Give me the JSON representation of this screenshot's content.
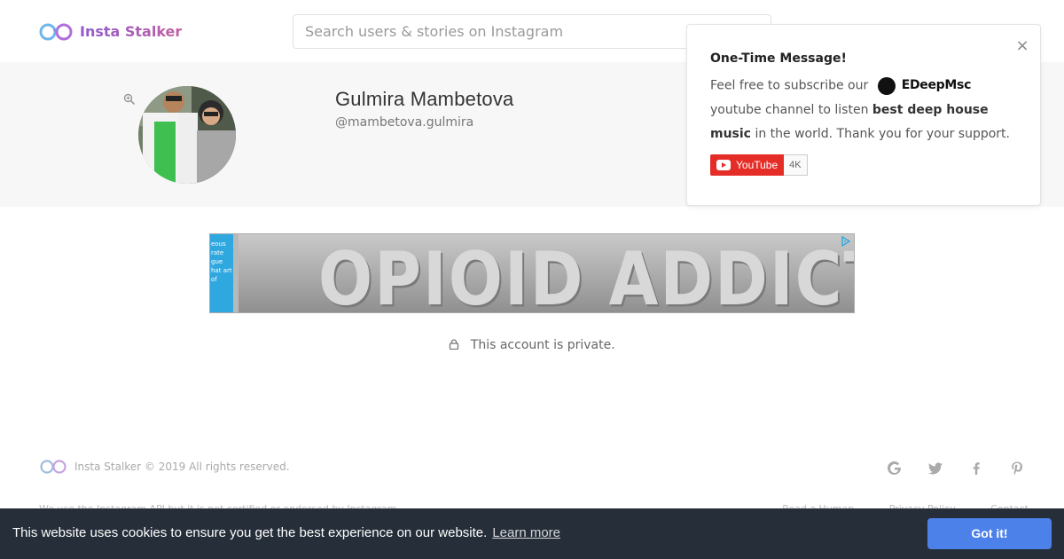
{
  "header": {
    "brand": "Insta Stalker",
    "search_placeholder": "Search users & stories on Instagram"
  },
  "profile": {
    "name": "Gulmira Mambetova",
    "handle": "@mambetova.gulmira"
  },
  "popup": {
    "title": "One-Time Message!",
    "text_before": "Feel free to subscribe our",
    "channel_name": "EDeepMsc",
    "text_after_channel": "youtube channel to listen",
    "highlight": "best deep house music",
    "text_end": "in the world. Thank you for your support.",
    "youtube_label": "YouTube",
    "youtube_count": "4K",
    "close_glyph": "×"
  },
  "ad": {
    "side_text": "eous rate gue hat art of",
    "headline": "OPIOID ADDICTION"
  },
  "private_notice": "This account is private.",
  "footer": {
    "copyright": "Insta Stalker © 2019 All rights reserved.",
    "disclaimer": "We use the Instagram API but it is not certified or endorsed by Instagram.",
    "links": [
      "Read a Human",
      "Privacy Policy",
      "Contact"
    ],
    "social_icons": [
      "google-icon",
      "twitter-icon",
      "facebook-icon",
      "pinterest-icon"
    ]
  },
  "cookie": {
    "message": "This website uses cookies to ensure you get the best experience on our website.",
    "link": "Learn more",
    "button": "Got it!"
  },
  "colors": {
    "brand": "#9b59b6",
    "cookie_bg": "#252e39",
    "cookie_button": "#4b81e8",
    "youtube_red": "#e52d27"
  }
}
